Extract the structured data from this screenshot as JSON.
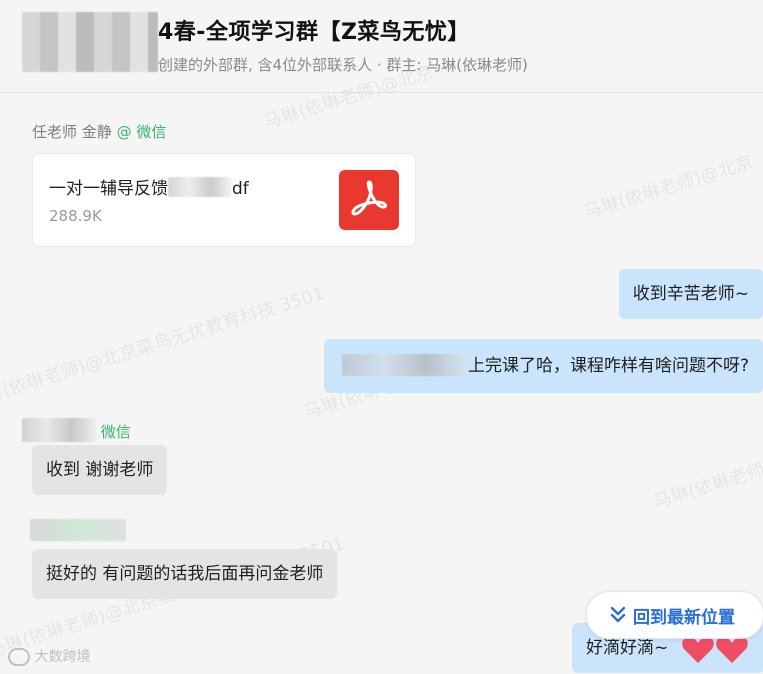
{
  "header": {
    "title": "4春-全项学习群【Z菜鸟无忧】",
    "subtitle": "创建的外部群, 含4位外部联系人 · 群主: 马琳(依琳老师)"
  },
  "watermark": {
    "text_a": "马琳(依琳老师)@北京菜鸟无忧教育科技 3501",
    "text_b": "马琳(依琳老师)@北京"
  },
  "messages": {
    "m1": {
      "sender": "任老师 金静",
      "sender_tag": "@ 微信",
      "file_name_prefix": "一对一辅导反馈",
      "file_name_suffix": "df",
      "file_size": "288.9K"
    },
    "m2": {
      "text": "收到辛苦老师~"
    },
    "m3": {
      "text": "上完课了哈，课程咋样有啥问题不呀?"
    },
    "m4": {
      "sender_tag": "微信",
      "text": "收到 谢谢老师"
    },
    "m5": {
      "text": "挺好的 有问题的话我后面再问金老师"
    },
    "m6": {
      "text": "好滴好滴~"
    }
  },
  "jump_button": {
    "label": "回到最新位置",
    "icon": "double-chevron-down-icon"
  },
  "footer_mark": "大数跨境",
  "colors": {
    "accent": "#2a6fd6",
    "wechat_green": "#3cb371",
    "pdf_red": "#e8382f",
    "right_bubble": "#c9e4fb",
    "left_bubble": "#e4e4e4"
  }
}
